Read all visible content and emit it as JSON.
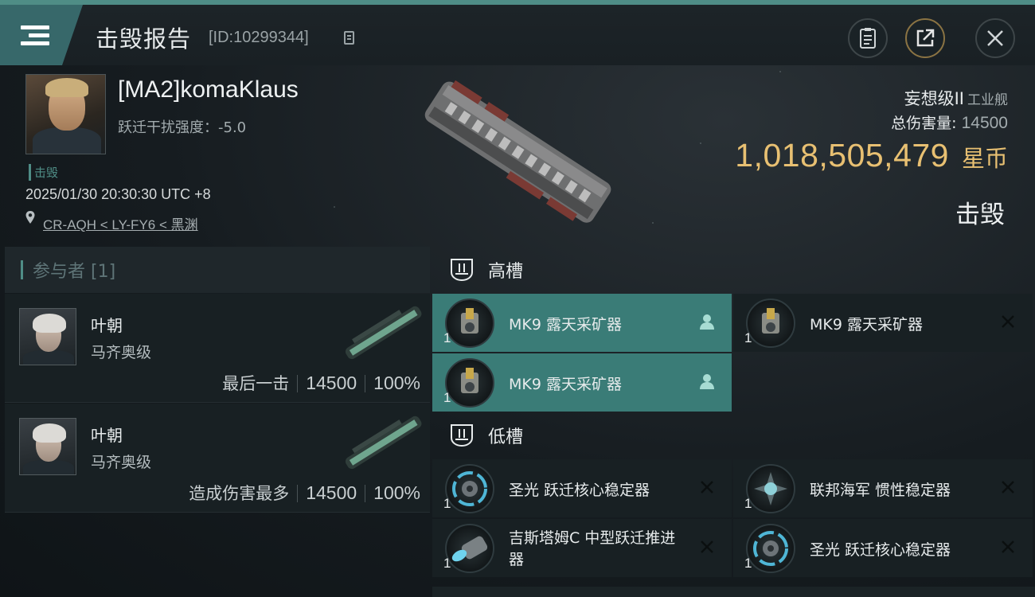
{
  "header": {
    "title": "击毁报告",
    "report_id": "[ID:10299344]"
  },
  "victim": {
    "name": "[MA2]komaKlaus",
    "warp_label": "跃迁干扰强度：",
    "warp_value": "-5.0",
    "status_tag": "击毁",
    "timestamp": "2025/01/30 20:30:30 UTC +8",
    "location": "CR-AQH < LY-FY6 < 黑渊",
    "ship_name": "妄想级II",
    "ship_type": "工业舰",
    "damage_label": "总伤害量:",
    "damage_value": "14500",
    "isk_value": "1,018,505,479",
    "isk_unit": "星币",
    "result": "击毁"
  },
  "participants": {
    "title": "参与者 [1]",
    "rows": [
      {
        "name": "叶朝",
        "ship": "马齐奥级",
        "role": "最后一击",
        "damage": "14500",
        "percent": "100%"
      },
      {
        "name": "叶朝",
        "ship": "马齐奥级",
        "role": "造成伤害最多",
        "damage": "14500",
        "percent": "100%"
      }
    ]
  },
  "fittings": {
    "high_label": "高槽",
    "low_label": "低槽",
    "high": [
      {
        "name": "MK9 露天采矿器",
        "qty": "1",
        "state": "fitted"
      },
      {
        "name": "MK9 露天采矿器",
        "qty": "1",
        "state": "destroyed"
      },
      {
        "name": "MK9 露天采矿器",
        "qty": "1",
        "state": "fitted"
      }
    ],
    "low": [
      {
        "name": "圣光 跃迁核心稳定器",
        "qty": "1",
        "state": "destroyed"
      },
      {
        "name": "联邦海军 惯性稳定器",
        "qty": "1",
        "state": "destroyed"
      },
      {
        "name": "吉斯塔姆C 中型跃迁推进器",
        "qty": "1",
        "state": "destroyed"
      },
      {
        "name": "圣光 跃迁核心稳定器",
        "qty": "1",
        "state": "destroyed"
      }
    ]
  },
  "colors": {
    "accent": "#4f8d86",
    "highlight_row": "#3a7c77",
    "isk_gold": "#e8c072"
  },
  "icons": [
    "menu-icon",
    "copy-icon",
    "clipboard-icon",
    "share-icon",
    "close-icon",
    "location-pin-icon",
    "high-slot-icon",
    "low-slot-icon",
    "pilot-icon",
    "destroyed-x-icon"
  ]
}
